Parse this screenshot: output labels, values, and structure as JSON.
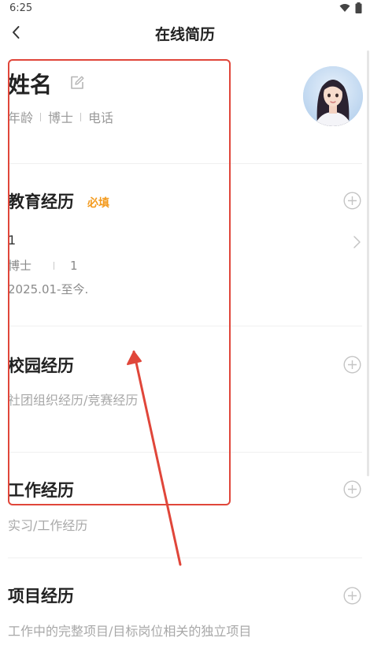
{
  "status_bar": {
    "time": "6:25"
  },
  "header": {
    "title": "在线简历"
  },
  "profile": {
    "name": "姓名",
    "meta": [
      "年龄",
      "博士",
      "电话"
    ]
  },
  "sections": {
    "education": {
      "title": "教育经历",
      "badge": "必填",
      "item": {
        "school": "1",
        "degree": "博士",
        "major": "1",
        "date": "2025.01-至今."
      }
    },
    "campus": {
      "title": "校园经历",
      "hint": "社团组织经历/竞赛经历"
    },
    "work": {
      "title": "工作经历",
      "hint": "实习/工作经历"
    },
    "project": {
      "title": "项目经历",
      "hint": "工作中的完整项目/目标岗位相关的独立项目"
    }
  },
  "colors": {
    "accent": "#f39a1d",
    "annotation": "#e0463a",
    "primary_text": "#222222",
    "secondary_text": "#9a9a9a"
  }
}
